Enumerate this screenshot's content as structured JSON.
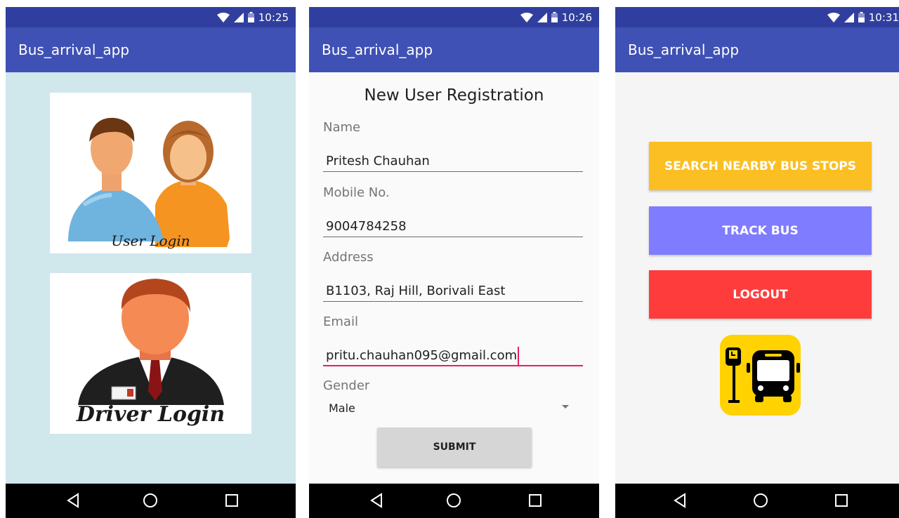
{
  "status_bar": {
    "times": [
      "10:25",
      "10:26",
      "10:31"
    ]
  },
  "app": {
    "title": "Bus_arrival_app"
  },
  "login_screen": {
    "user_card": {
      "caption": "User Login"
    },
    "driver_card": {
      "caption": "Driver Login"
    }
  },
  "registration": {
    "title": "New User Registration",
    "fields": [
      {
        "label": "Name",
        "value": "Pritesh Chauhan"
      },
      {
        "label": "Mobile No.",
        "value": "9004784258"
      },
      {
        "label": "Address",
        "value": "B1103, Raj Hill, Borivali East"
      },
      {
        "label": "Email",
        "value": "pritu.chauhan095@gmail.com"
      }
    ],
    "gender": {
      "label": "Gender",
      "selected": "Male"
    },
    "submit_label": "SUBMIT"
  },
  "menu_screen": {
    "buttons": [
      "SEARCH NEARBY BUS STOPS",
      "TRACK BUS",
      "LOGOUT"
    ]
  },
  "colors": {
    "status_bar": "#303f9f",
    "app_bar": "#3f51b5",
    "login_bg": "#d0e7ec",
    "search_btn": "#fbbf24",
    "track_btn": "#7f7cff",
    "logout_btn": "#fe3c3c",
    "focus_accent": "#e91e63"
  },
  "icons": [
    "wifi-icon",
    "signal-icon",
    "battery-icon",
    "back-icon",
    "home-icon",
    "recents-icon",
    "bus-stop-icon"
  ]
}
